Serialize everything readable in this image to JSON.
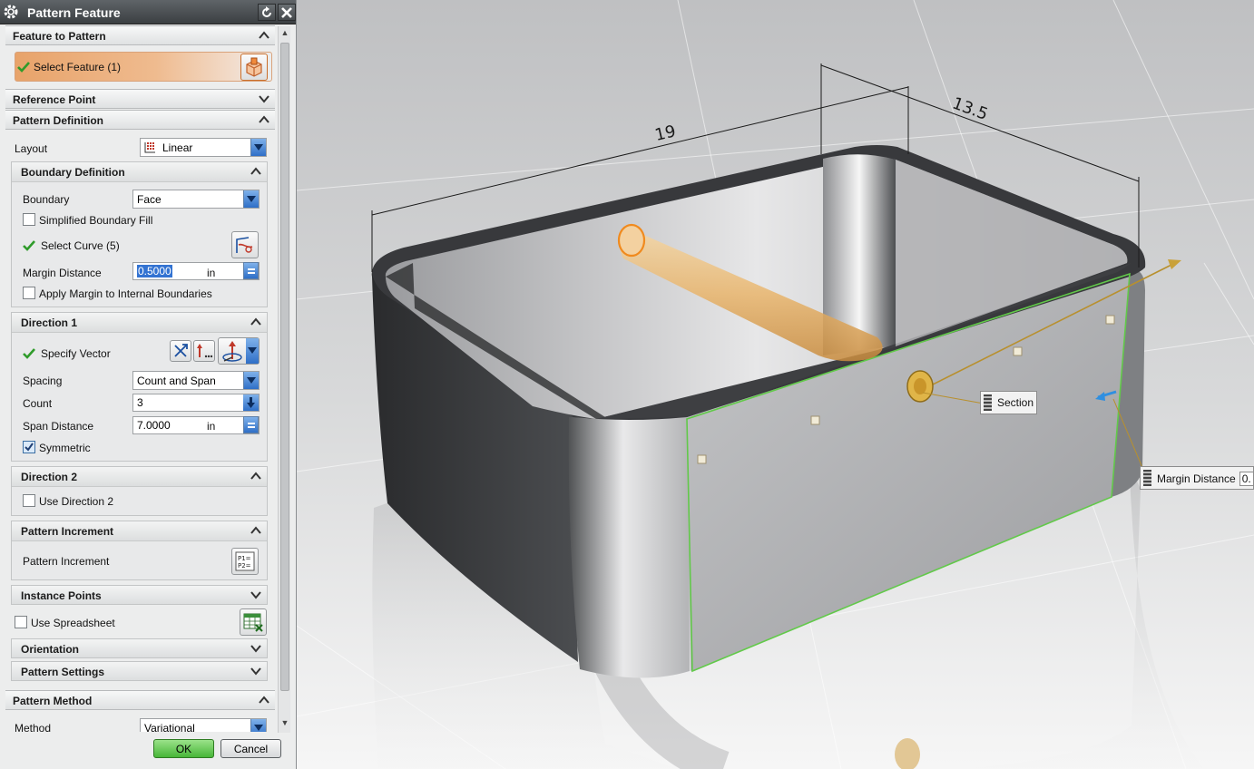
{
  "dialog": {
    "title": "Pattern Feature",
    "groups": {
      "feature_to_pattern": "Feature to Pattern",
      "select_feature": "Select Feature (1)",
      "reference_point": "Reference Point",
      "pattern_definition": "Pattern Definition",
      "layout_label": "Layout",
      "layout_value": "Linear",
      "boundary_definition": "Boundary Definition",
      "boundary_label": "Boundary",
      "boundary_value": "Face",
      "simplified_boundary_fill": "Simplified Boundary Fill",
      "select_curve": "Select Curve (5)",
      "margin_distance_label": "Margin Distance",
      "margin_distance_value": "0.5000",
      "margin_unit": "in",
      "apply_margin": "Apply Margin to Internal Boundaries",
      "direction1": "Direction 1",
      "specify_vector": "Specify Vector",
      "spacing_label": "Spacing",
      "spacing_value": "Count and Span",
      "count_label": "Count",
      "count_value": "3",
      "span_distance_label": "Span Distance",
      "span_distance_value": "7.0000",
      "span_unit": "in",
      "symmetric": "Symmetric",
      "direction2": "Direction 2",
      "use_direction2": "Use Direction 2",
      "pattern_increment_header": "Pattern Increment",
      "pattern_increment_label": "Pattern Increment",
      "instance_points": "Instance Points",
      "use_spreadsheet": "Use Spreadsheet",
      "orientation": "Orientation",
      "pattern_settings": "Pattern Settings",
      "pattern_method": "Pattern Method",
      "method_label": "Method",
      "method_value": "Variational"
    },
    "checkboxes": {
      "simplified_boundary_fill": false,
      "apply_margin": false,
      "symmetric": true,
      "use_direction2": false,
      "use_spreadsheet": false
    },
    "buttons": {
      "ok": "OK",
      "cancel": "Cancel"
    }
  },
  "viewport": {
    "dimension_19": "19",
    "dimension_13_5": "13.5",
    "section_label": "Section",
    "margin_distance_label": "Margin Distance",
    "margin_distance_value": "0."
  },
  "colors": {
    "accent_orange": "#e8a36a",
    "selection_green": "#62c94a",
    "handle_gold": "#c9a13a"
  }
}
